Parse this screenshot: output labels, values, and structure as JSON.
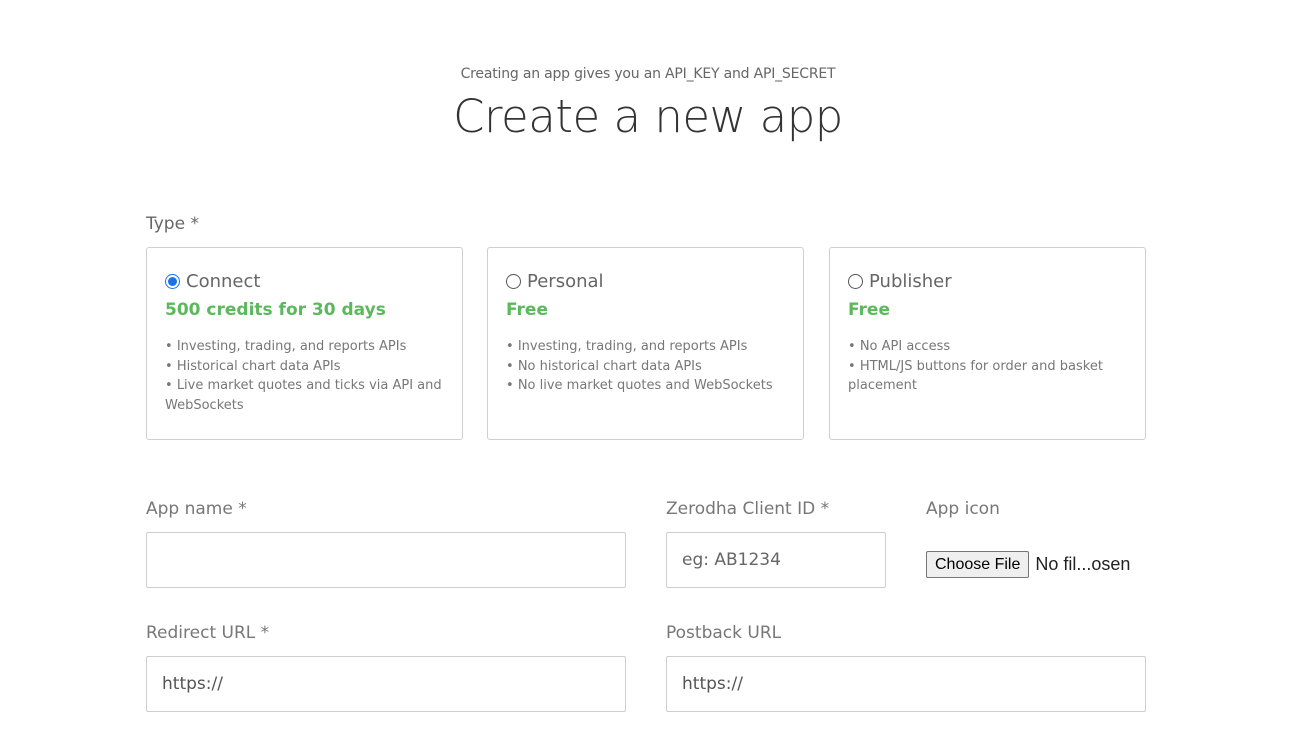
{
  "header": {
    "subtitle": "Creating an app gives you an API_KEY and API_SECRET",
    "title": "Create a new app"
  },
  "type_section": {
    "label": "Type *",
    "selected": "Connect",
    "options": [
      {
        "name": "Connect",
        "price": "500 credits for 30 days",
        "features": [
          "Investing, trading, and reports APIs",
          "Historical chart data APIs",
          "Live market quotes and ticks via API and WebSockets"
        ]
      },
      {
        "name": "Personal",
        "price": "Free",
        "features": [
          "Investing, trading, and reports APIs",
          "No historical chart data APIs",
          "No live market quotes and WebSockets"
        ]
      },
      {
        "name": "Publisher",
        "price": "Free",
        "features": [
          "No API access",
          "HTML/JS buttons for order and basket placement"
        ]
      }
    ]
  },
  "form": {
    "app_name": {
      "label": "App name *",
      "value": "",
      "placeholder": ""
    },
    "client_id": {
      "label": "Zerodha Client ID *",
      "value": "",
      "placeholder": "eg: AB1234"
    },
    "app_icon": {
      "label": "App icon",
      "button_label": "Choose File",
      "status": "No fil...osen"
    },
    "redirect_url": {
      "label": "Redirect URL *",
      "value": "https://",
      "placeholder": ""
    },
    "postback_url": {
      "label": "Postback URL",
      "value": "https://",
      "placeholder": ""
    }
  },
  "colors": {
    "accent_green": "#5cb85c",
    "radio_blue": "#1a73e8",
    "border": "#cfcfcf"
  }
}
